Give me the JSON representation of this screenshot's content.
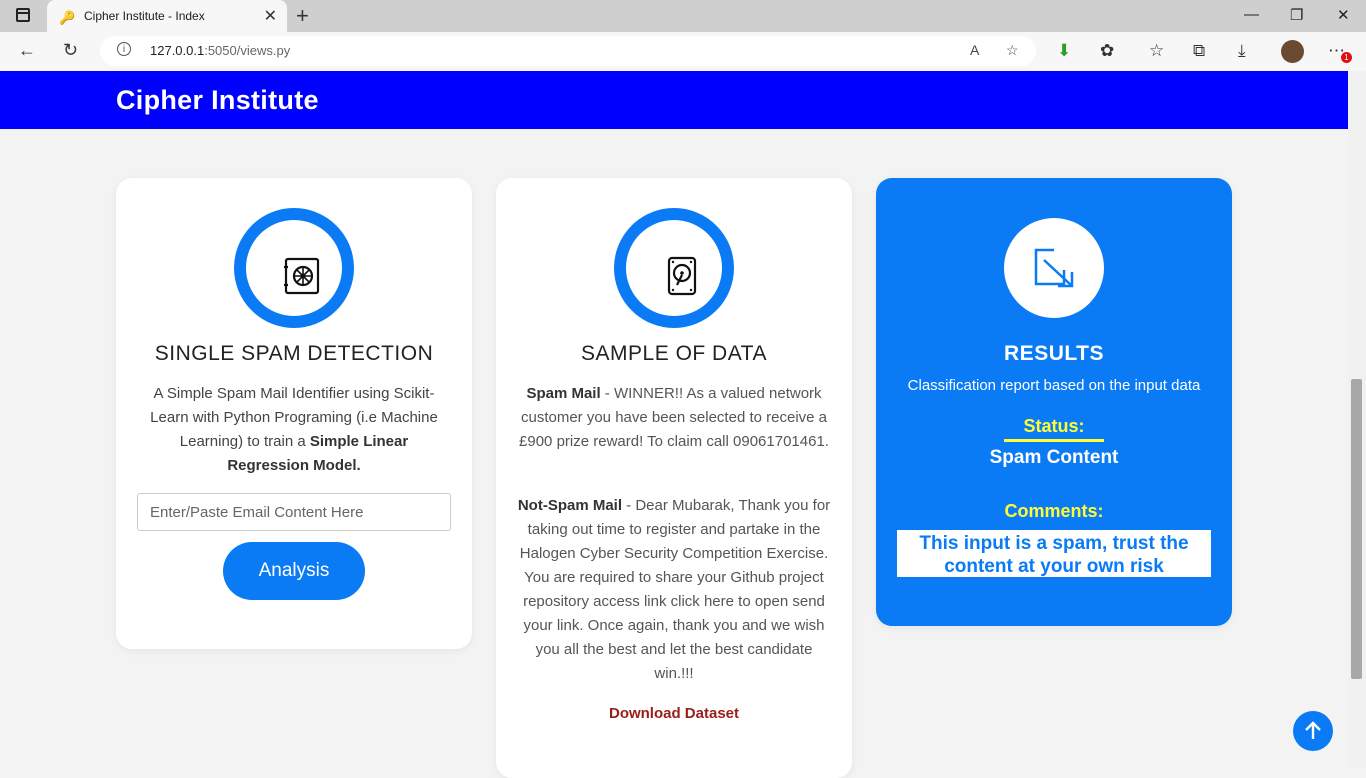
{
  "browser": {
    "tab_title": "Cipher Institute - Index",
    "favicon": "key-icon",
    "url_host": "127.0.0.1",
    "url_path": ":5050/views.py",
    "notification_count": "1"
  },
  "header": {
    "brand": "Cipher Institute"
  },
  "cards": {
    "detection": {
      "title": "SINGLE SPAM DETECTION",
      "desc_intro": "A Simple Spam Mail Identifier using Scikit-Learn with Python Programing (i.e Machine Learning) to train a ",
      "desc_bold": "Simple Linear Regression Model.",
      "input_placeholder": "Enter/Paste Email Content Here",
      "button_label": "Analysis",
      "icon": "safe-icon"
    },
    "sample": {
      "title": "SAMPLE OF DATA",
      "spam_label": "Spam Mail",
      "spam_text": " - WINNER!! As a valued network customer you have been selected to receive a £900 prize reward! To claim call 09061701461.",
      "notspam_label": "Not-Spam Mail",
      "notspam_text": " - Dear Mubarak, Thank you for taking out time to register and partake in the Halogen Cyber Security Competition Exercise. You are required to share your Github project repository access link click here to open send your link. Once again, thank you and we wish you all the best and let the best candidate win.!!!",
      "download_label": "Download Dataset",
      "icon": "hard-drive-icon"
    },
    "results": {
      "title": "RESULTS",
      "subtitle": "Classification report based on the input data",
      "status_label": "Status:",
      "status_value": "Spam Content",
      "comments_label": "Comments:",
      "comment_text": "This input is a spam, trust the content at your own risk",
      "icon": "arrow-down-right-icon"
    }
  },
  "colors": {
    "header": "#0000ff",
    "accent": "#0a7bf5",
    "highlight": "#ffff33",
    "download": "#9b1c1c"
  }
}
